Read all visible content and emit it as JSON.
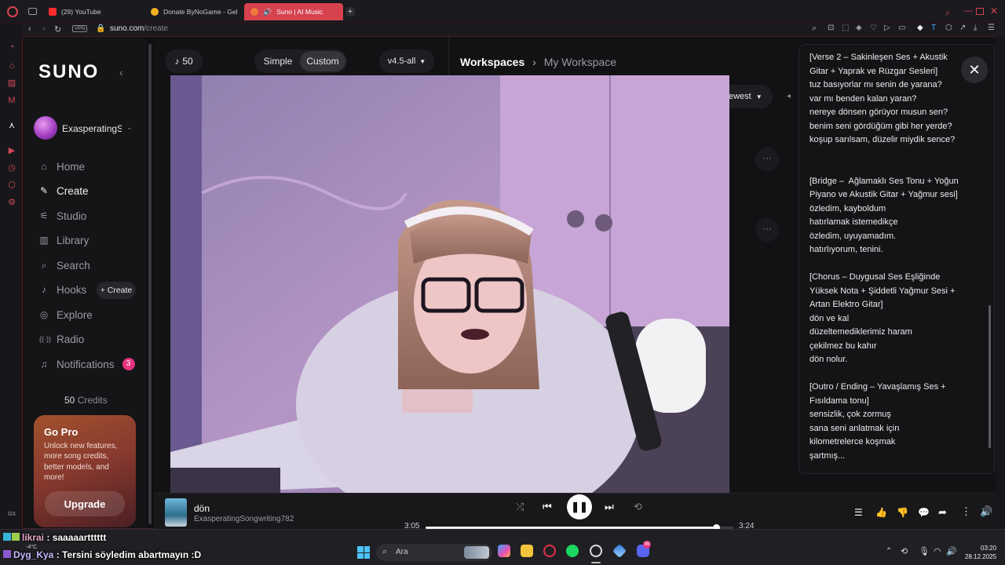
{
  "browser": {
    "tabs": [
      {
        "label": "(29) YouTube",
        "color": "#ff2d2d"
      },
      {
        "label": "Donate ByNoGame - Gel",
        "color": "#f0b020"
      },
      {
        "label": "Suno | AI Music",
        "color": "#f07a3a"
      }
    ],
    "vpn_badge": "VPN",
    "url_host": "suno.com",
    "url_path": "/create"
  },
  "sidebar": {
    "logo": "SUNO",
    "username": "ExasperatingSo",
    "items": [
      {
        "label": "Home",
        "icon": "home-icon",
        "glyph": "⌂"
      },
      {
        "label": "Create",
        "icon": "create-icon",
        "glyph": "✎"
      },
      {
        "label": "Studio",
        "icon": "studio-icon",
        "glyph": "⚟"
      },
      {
        "label": "Library",
        "icon": "library-icon",
        "glyph": "▥"
      },
      {
        "label": "Search",
        "icon": "search-icon",
        "glyph": "⌕"
      },
      {
        "label": "Hooks",
        "icon": "hooks-icon",
        "glyph": "♪"
      },
      {
        "label": "Explore",
        "icon": "explore-icon",
        "glyph": "◎"
      },
      {
        "label": "Radio",
        "icon": "radio-icon",
        "glyph": "((·))"
      },
      {
        "label": "Notifications",
        "icon": "bell-icon",
        "glyph": "♫"
      }
    ],
    "hooks_create": "+ Create",
    "notifications_count": "3",
    "credits_value": "50",
    "credits_label": "Credits",
    "gopro": {
      "title": "Go Pro",
      "body": "Unlock new features, more song credits, better models, and more!",
      "button": "Upgrade"
    }
  },
  "create_panel": {
    "credits": "50",
    "mode_simple": "Simple",
    "mode_custom": "Custom",
    "model": "v4.5-all",
    "sort": "ewest"
  },
  "workspace": {
    "crumb_root": "Workspaces",
    "crumb_current": "My Workspace"
  },
  "lyrics": {
    "text": "[Verse 2 – Sakinleşen Ses + Akustik Gitar + Yaprak ve Rüzgar Sesleri]\ntuz basıyorlar mı senin de yarana?\nvar mı benden kalan yaran?\nnereye dönsen görüyor musun sen?\nbenim seni gördüğüm gibi her yerde?\nkoşup sarılsam, düzelir miydik sence?\n\n\n[Bridge –  Ağlamaklı Ses Tonu + Yoğun Piyano ve Akustik Gitar + Yağmur sesi]\nözledim, kayboldum\nhatırlamak istemedikçe\nözledim, uyuyamadım.\nhatırlıyorum, tenini.\n\n[Chorus – Duygusal Ses Eşliğinde Yüksek Nota + Şiddetli Yağmur Sesi + Artan Elektro Gitar]\ndön ve kal\ndüzeltemediklerimiz haram\nçekilmez bu kahır\ndön nolur.\n\n[Outro / Ending – Yavaşlamış Ses + Fısıldama tonu]\nsensizlik, çok zormuş\nsana seni anlatmak için\nkilometrelerce koşmak\nşartmış..."
  },
  "player": {
    "title": "dön",
    "artist": "ExasperatingSongwriting782",
    "elapsed": "3:05",
    "duration": "3:24",
    "progress": 0.944
  },
  "overlay_chat": [
    {
      "user": "likrai",
      "sep": " : ",
      "msg": "saaaaartttttt"
    },
    {
      "user": "Dyg_Kya",
      "sep": " : ",
      "msg": "Tersini söyledim abartmayın :D"
    }
  ],
  "taskbar": {
    "search_label": "Ara",
    "weather_temp": "-4°C",
    "time": "03:20",
    "date": "28.12.2025",
    "gx_label": "GX",
    "discord_badge": "99"
  },
  "colors": {
    "accent": "#d7424f",
    "notif_badge": "#e8337f"
  }
}
